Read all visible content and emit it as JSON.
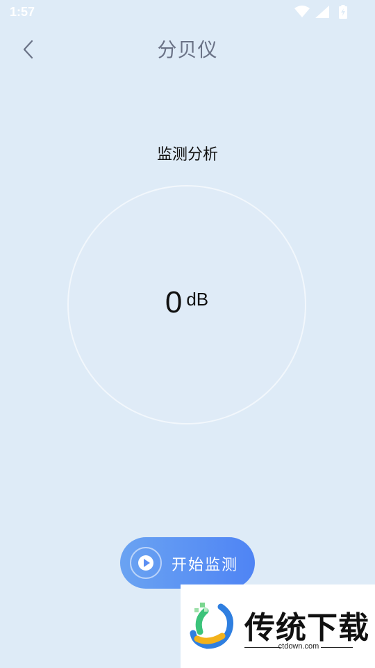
{
  "status_bar": {
    "time": "1:57",
    "icons": [
      "wifi-icon",
      "cell-signal-icon",
      "battery-charging-icon"
    ]
  },
  "header": {
    "back_icon": "chevron-left-icon",
    "title": "分贝仪"
  },
  "section": {
    "title": "监测分析"
  },
  "meter": {
    "value": "0",
    "unit": "dB"
  },
  "actions": {
    "start_label": "开始监测",
    "start_icon": "play-icon",
    "accent_start": "#6aa3f2",
    "accent_end": "#4f84f4"
  },
  "watermark": {
    "brand": "传统下载",
    "url": "ctdown.com"
  },
  "colors": {
    "background": "#deebf7",
    "title": "#6a7286"
  }
}
